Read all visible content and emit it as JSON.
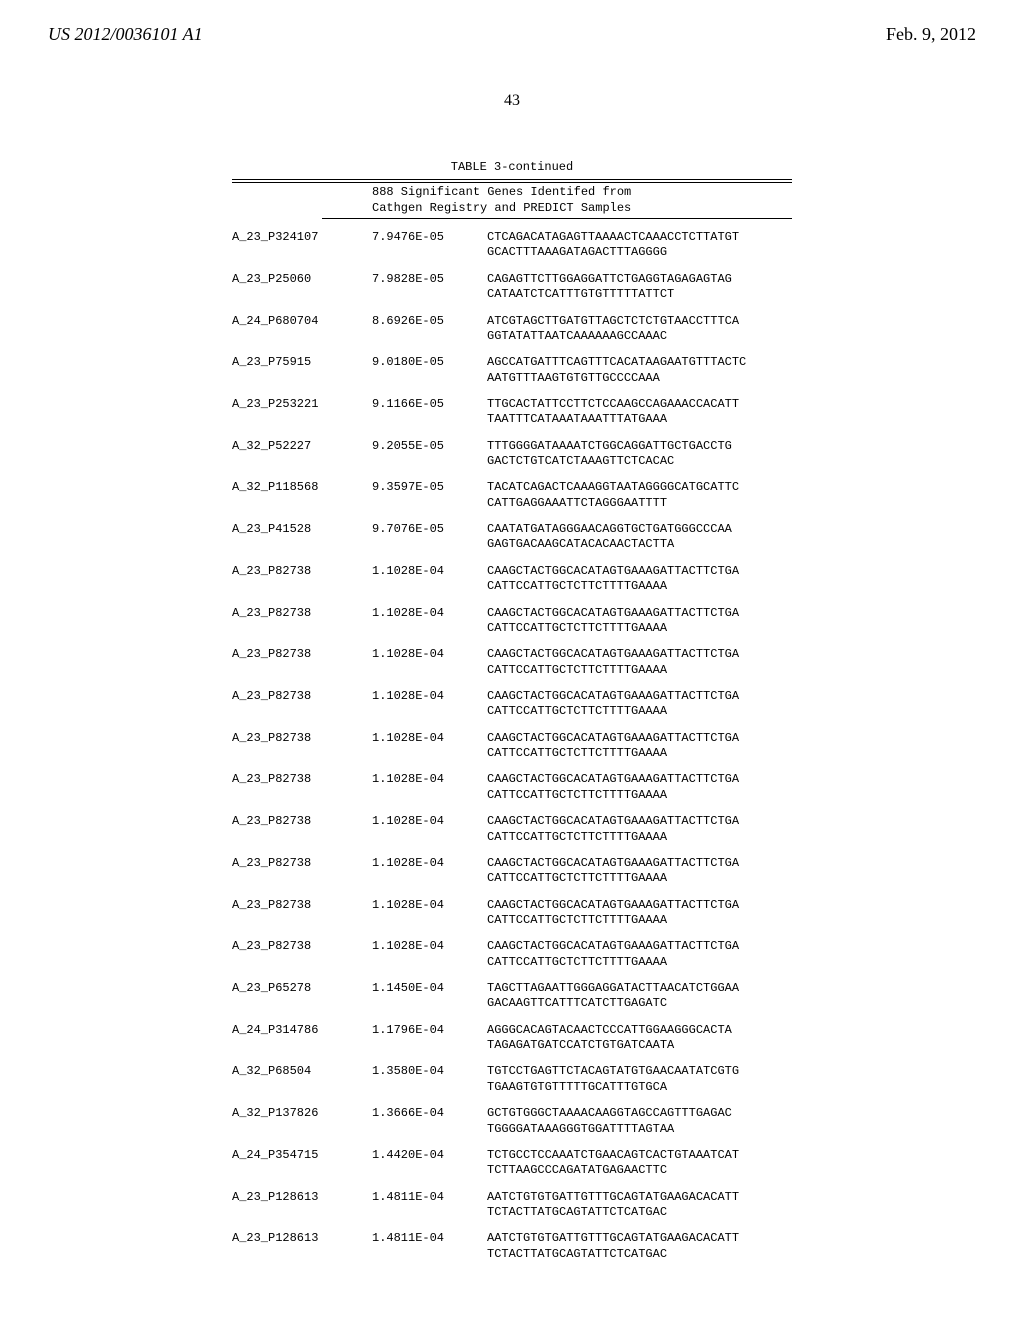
{
  "header": {
    "publication_number": "US 2012/0036101 A1",
    "date": "Feb. 9, 2012"
  },
  "page_number": "43",
  "table": {
    "title": "TABLE 3-continued",
    "subtitle_line1": "888 Significant Genes Identifed from",
    "subtitle_line2": "Cathgen Registry and PREDICT Samples",
    "rows": [
      {
        "id": "A_23_P324107",
        "val": "7.9476E-05",
        "seq1": "CTCAGACATAGAGTTAAAACTCAAACCTCTTATGT",
        "seq2": "GCACTTTAAAGATAGACTTTAGGGG"
      },
      {
        "id": "A_23_P25060",
        "val": "7.9828E-05",
        "seq1": "CAGAGTTCTTGGAGGATTCTGAGGTAGAGAGTAG",
        "seq2": "CATAATCTCATTTGTGTTTTTATTCT"
      },
      {
        "id": "A_24_P680704",
        "val": "8.6926E-05",
        "seq1": "ATCGTAGCTTGATGTTAGCTCTCTGTAACCTTTCA",
        "seq2": "GGTATATTAATCAAAAAAGCCAAAC"
      },
      {
        "id": "A_23_P75915",
        "val": "9.0180E-05",
        "seq1": "AGCCATGATTTCAGTTTCACATAAGAATGTTTACTC",
        "seq2": "AATGTTTAAGTGTGTTGCCCCAAA"
      },
      {
        "id": "A_23_P253221",
        "val": "9.1166E-05",
        "seq1": "TTGCACTATTCCTTCTCCAAGCCAGAAACCACATT",
        "seq2": "TAATTTCATAAATAAATTTATGAAA"
      },
      {
        "id": "A_32_P52227",
        "val": "9.2055E-05",
        "seq1": "TTTGGGGATAAAATCTGGCAGGATTGCTGACCTG",
        "seq2": "GACTCTGTCATCTAAAGTTCTCACAC"
      },
      {
        "id": "A_32_P118568",
        "val": "9.3597E-05",
        "seq1": "TACATCAGACTCAAAGGTAATAGGGGCATGCATTC",
        "seq2": "CATTGAGGAAATTCTAGGGAATTTT"
      },
      {
        "id": "A_23_P41528",
        "val": "9.7076E-05",
        "seq1": "CAATATGATAGGGAACAGGTGCTGATGGGCCCAA",
        "seq2": "GAGTGACAAGCATACACAACTACTTA"
      },
      {
        "id": "A_23_P82738",
        "val": "1.1028E-04",
        "seq1": "CAAGCTACTGGCACATAGTGAAAGATTACTTCTGA",
        "seq2": "CATTCCATTGCTCTTCTTTTGAAAA"
      },
      {
        "id": "A_23_P82738",
        "val": "1.1028E-04",
        "seq1": "CAAGCTACTGGCACATAGTGAAAGATTACTTCTGA",
        "seq2": "CATTCCATTGCTCTTCTTTTGAAAA"
      },
      {
        "id": "A_23_P82738",
        "val": "1.1028E-04",
        "seq1": "CAAGCTACTGGCACATAGTGAAAGATTACTTCTGA",
        "seq2": "CATTCCATTGCTCTTCTTTTGAAAA"
      },
      {
        "id": "A_23_P82738",
        "val": "1.1028E-04",
        "seq1": "CAAGCTACTGGCACATAGTGAAAGATTACTTCTGA",
        "seq2": "CATTCCATTGCTCTTCTTTTGAAAA"
      },
      {
        "id": "A_23_P82738",
        "val": "1.1028E-04",
        "seq1": "CAAGCTACTGGCACATAGTGAAAGATTACTTCTGA",
        "seq2": "CATTCCATTGCTCTTCTTTTGAAAA"
      },
      {
        "id": "A_23_P82738",
        "val": "1.1028E-04",
        "seq1": "CAAGCTACTGGCACATAGTGAAAGATTACTTCTGA",
        "seq2": "CATTCCATTGCTCTTCTTTTGAAAA"
      },
      {
        "id": "A_23_P82738",
        "val": "1.1028E-04",
        "seq1": "CAAGCTACTGGCACATAGTGAAAGATTACTTCTGA",
        "seq2": "CATTCCATTGCTCTTCTTTTGAAAA"
      },
      {
        "id": "A_23_P82738",
        "val": "1.1028E-04",
        "seq1": "CAAGCTACTGGCACATAGTGAAAGATTACTTCTGA",
        "seq2": "CATTCCATTGCTCTTCTTTTGAAAA"
      },
      {
        "id": "A_23_P82738",
        "val": "1.1028E-04",
        "seq1": "CAAGCTACTGGCACATAGTGAAAGATTACTTCTGA",
        "seq2": "CATTCCATTGCTCTTCTTTTGAAAA"
      },
      {
        "id": "A_23_P82738",
        "val": "1.1028E-04",
        "seq1": "CAAGCTACTGGCACATAGTGAAAGATTACTTCTGA",
        "seq2": "CATTCCATTGCTCTTCTTTTGAAAA"
      },
      {
        "id": "A_23_P65278",
        "val": "1.1450E-04",
        "seq1": "TAGCTTAGAATTGGGAGGATACTTAACATCTGGAA",
        "seq2": "GACAAGTTCATTTCATCTTGAGATC"
      },
      {
        "id": "A_24_P314786",
        "val": "1.1796E-04",
        "seq1": "AGGGCACAGTACAACTCCCATTGGAAGGGCACTA",
        "seq2": "TAGAGATGATCCATCTGTGATCAATA"
      },
      {
        "id": "A_32_P68504",
        "val": "1.3580E-04",
        "seq1": "TGTCCTGAGTTCTACAGTATGTGAACAATATCGTG",
        "seq2": "TGAAGTGTGTTTTTGCATTTGTGCA"
      },
      {
        "id": "A_32_P137826",
        "val": "1.3666E-04",
        "seq1": "GCTGTGGGCTAAAACAAGGTAGCCAGTTTGAGAC",
        "seq2": "TGGGGATAAAGGGTGGATTTTAGTAA"
      },
      {
        "id": "A_24_P354715",
        "val": "1.4420E-04",
        "seq1": "TCTGCCTCCAAATCTGAACAGTCACTGTAAATCAT",
        "seq2": "TCTTAAGCCCAGATATGAGAACTTC"
      },
      {
        "id": "A_23_P128613",
        "val": "1.4811E-04",
        "seq1": "AATCTGTGTGATTGTTTGCAGTATGAAGACACATT",
        "seq2": "TCTACTTATGCAGTATTCTCATGAC"
      },
      {
        "id": "A_23_P128613",
        "val": "1.4811E-04",
        "seq1": "AATCTGTGTGATTGTTTGCAGTATGAAGACACATT",
        "seq2": "TCTACTTATGCAGTATTCTCATGAC"
      }
    ]
  }
}
